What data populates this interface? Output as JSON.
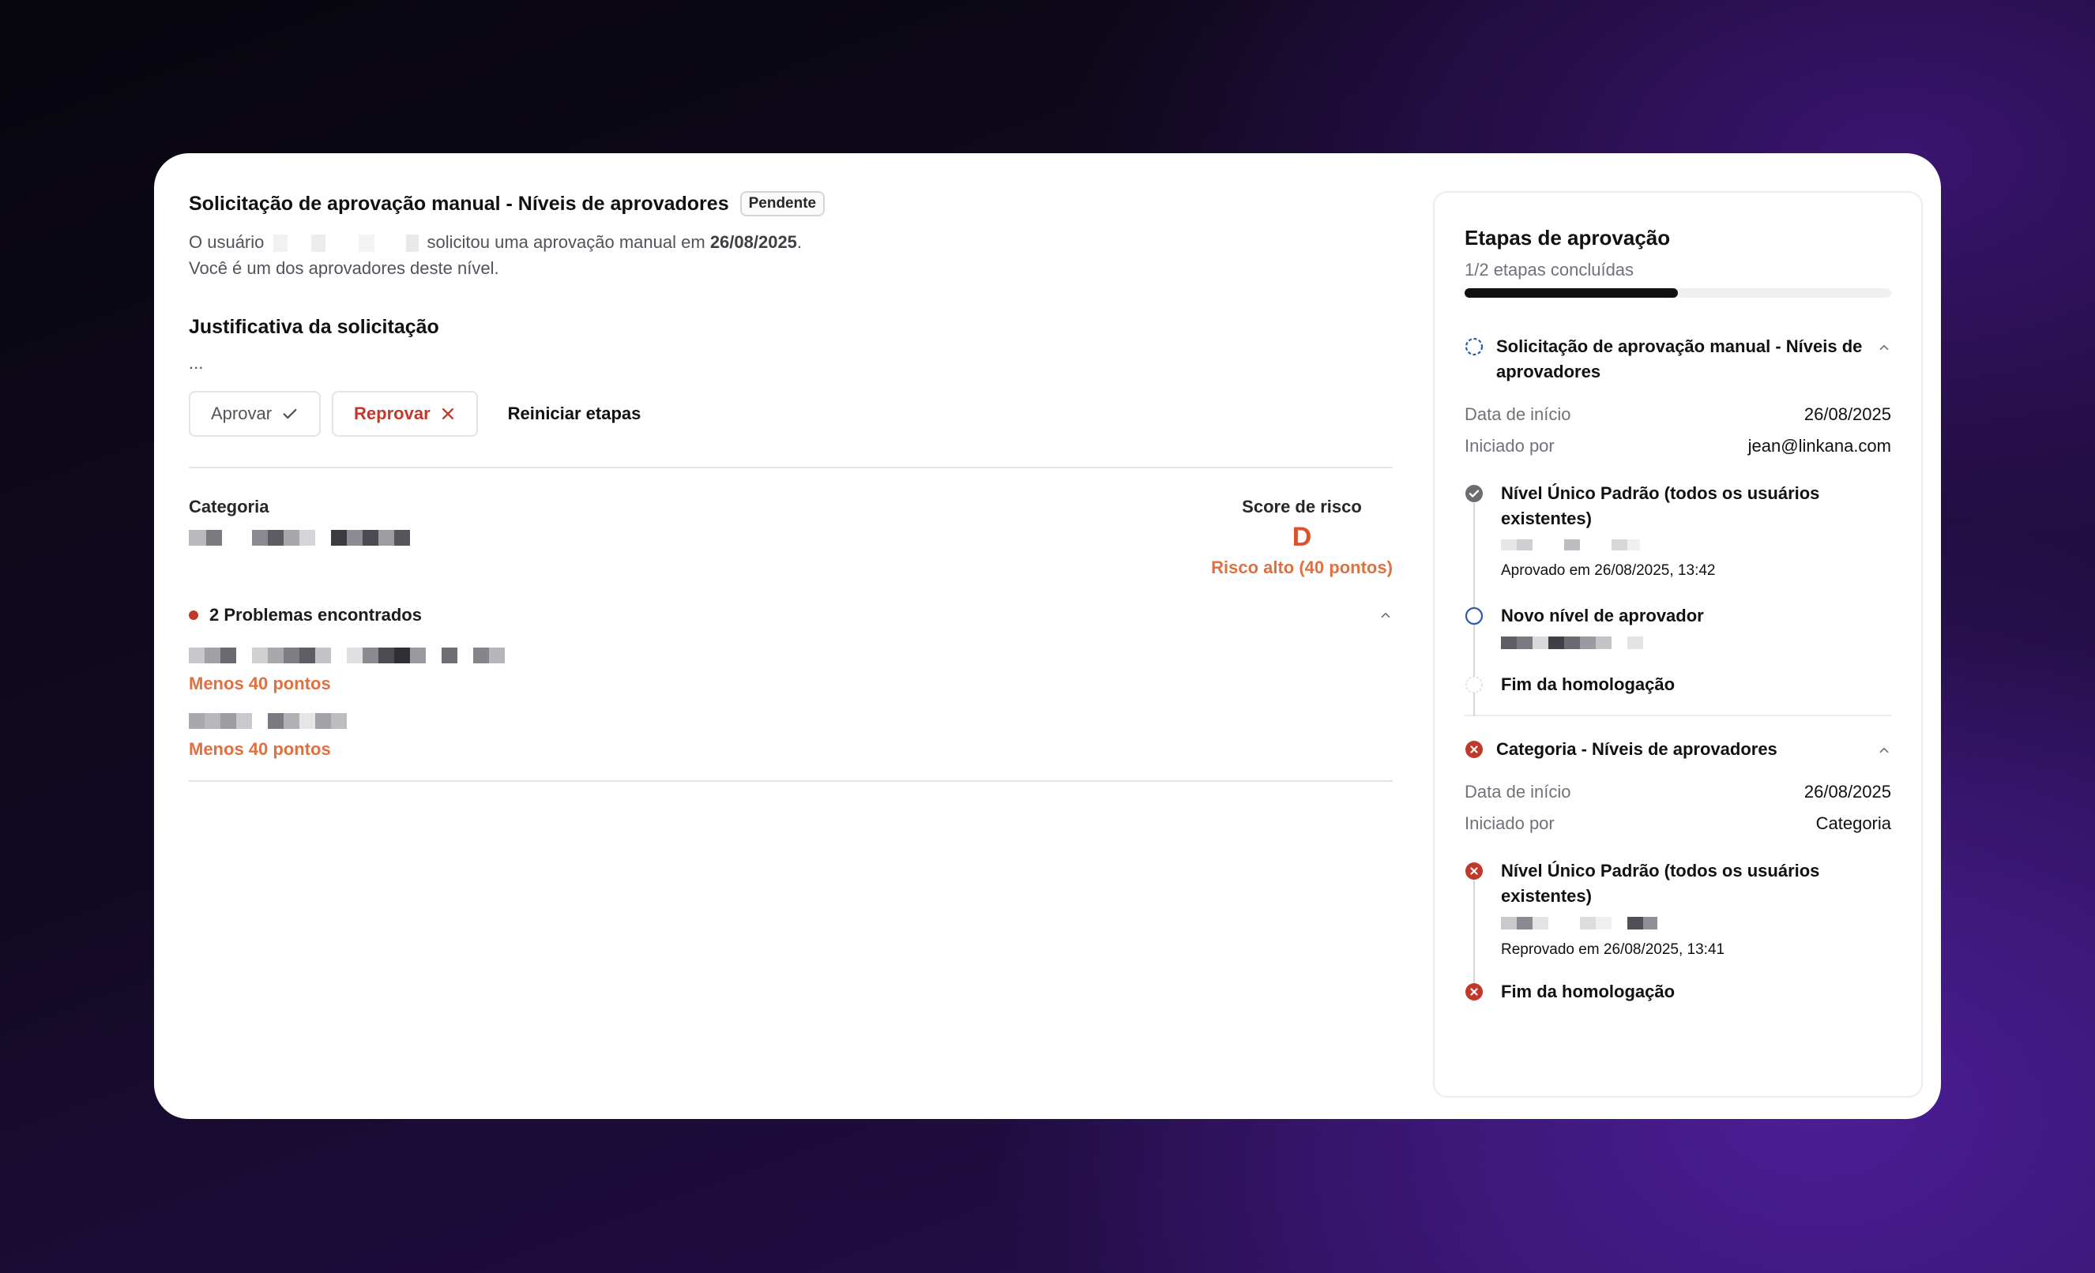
{
  "request": {
    "title": "Solicitação de aprovação manual - Níveis de aprovadores",
    "status_badge": "Pendente",
    "line1_prefix": "O usuário",
    "line1_middle": " solicitou uma aprovação manual em ",
    "line1_date": "26/08/2025",
    "line1_suffix": ".",
    "line2": "Você é um dos aprovadores deste nível."
  },
  "justification": {
    "heading": "Justificativa da solicitação",
    "text": "..."
  },
  "actions": {
    "approve_label": "Aprovar",
    "reject_label": "Reprovar",
    "restart_label": "Reiniciar etapas"
  },
  "category": {
    "label": "Categoria"
  },
  "risk": {
    "label": "Score de risco",
    "letter": "D",
    "description": "Risco alto (40 pontos)"
  },
  "problems": {
    "heading": "2 Problemas encontrados",
    "items": [
      {
        "points": "Menos 40 pontos"
      },
      {
        "points": "Menos 40 pontos"
      }
    ]
  },
  "stages": {
    "title": "Etapas de aprovação",
    "progress_text": "1/2 etapas concluídas",
    "progress_fraction": 0.5,
    "sections": [
      {
        "title": "Solicitação de aprovação manual - Níveis de aprovadores",
        "start_label": "Data de início",
        "start_value": "26/08/2025",
        "by_label": "Iniciado por",
        "by_value": "jean@linkana.com",
        "steps": [
          {
            "title": "Nível Único Padrão (todos os usuários existentes)",
            "meta": "Aprovado em 26/08/2025, 13:42"
          },
          {
            "title": "Novo nível de aprovador"
          },
          {
            "title": "Fim da homologação"
          }
        ]
      },
      {
        "title": "Categoria - Níveis de aprovadores",
        "start_label": "Data de início",
        "start_value": "26/08/2025",
        "by_label": "Iniciado por",
        "by_value": "Categoria",
        "steps": [
          {
            "title": "Nível Único Padrão (todos os usuários existentes)",
            "meta": "Reprovado em 26/08/2025, 13:41"
          },
          {
            "title": "Fim da homologação"
          }
        ]
      }
    ]
  },
  "colors": {
    "accent_red": "#c0392b",
    "risk_orange": "#e07040",
    "approved_gray": "#6b6b70",
    "pending_blue": "#2f5aa8"
  }
}
